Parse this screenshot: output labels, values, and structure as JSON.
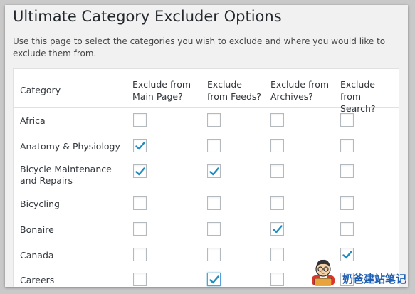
{
  "page": {
    "title": "Ultimate Category Excluder Options",
    "description": "Use this page to select the categories you wish to exclude and where you would like to exclude them from."
  },
  "table": {
    "columns": [
      "Category",
      "Exclude from Main Page?",
      "Exclude from Feeds?",
      "Exclude from Archives?",
      "Exclude from Search?"
    ],
    "rows": [
      {
        "category": "Africa",
        "main": false,
        "feeds": false,
        "archives": false,
        "search": false
      },
      {
        "category": "Anatomy & Physiology",
        "main": true,
        "feeds": false,
        "archives": false,
        "search": false
      },
      {
        "category": "Bicycle Maintenance and Repairs",
        "main": true,
        "feeds": true,
        "archives": false,
        "search": false
      },
      {
        "category": "Bicycling",
        "main": false,
        "feeds": false,
        "archives": false,
        "search": false
      },
      {
        "category": "Bonaire",
        "main": false,
        "feeds": false,
        "archives": true,
        "search": false
      },
      {
        "category": "Canada",
        "main": false,
        "feeds": false,
        "archives": false,
        "search": true
      },
      {
        "category": "Careers",
        "main": false,
        "feeds": true,
        "archives": false,
        "search": false
      }
    ]
  },
  "watermark": {
    "text": "奶爸建站笔记",
    "icon": "cartoon-avatar-icon"
  },
  "colors": {
    "check": "#1e8cbe",
    "background": "#f1f1f1",
    "title": "#23282d"
  }
}
